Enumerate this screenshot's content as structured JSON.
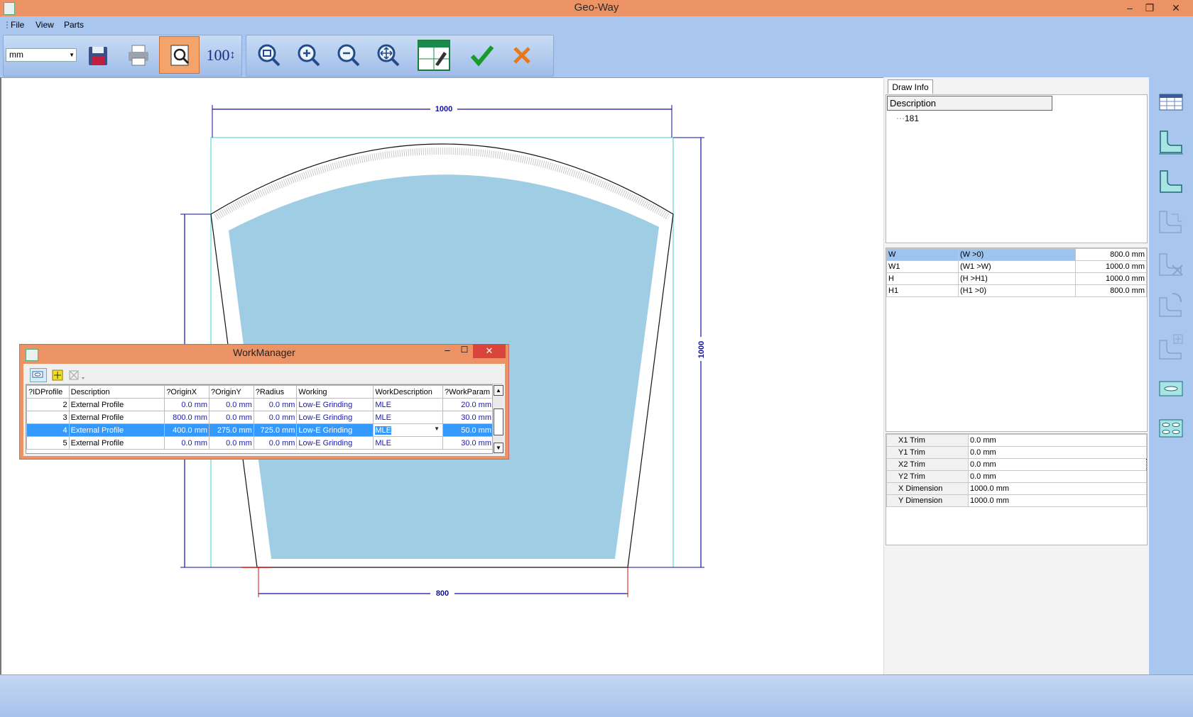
{
  "app": {
    "title": "Geo-Way"
  },
  "window_controls": {
    "minimize": "–",
    "restore": "❐",
    "close": "✕"
  },
  "menu": [
    "File",
    "View",
    "Parts"
  ],
  "toolbar": {
    "unit_value": "mm",
    "zoom_label": "100",
    "icons": [
      "save-icon",
      "print-icon",
      "preview-icon",
      "zoom-100-icon",
      "zoom-window-icon",
      "zoom-in-icon",
      "zoom-out-icon",
      "zoom-pan-icon",
      "draw-info-icon",
      "confirm-icon",
      "cancel-icon"
    ]
  },
  "drawing": {
    "dim_top": "1000",
    "dim_right": "1000",
    "dim_bottom": "800",
    "colors": {
      "glass": "#9ecde4",
      "dimension": "#1010a0",
      "highlight": "#d01010",
      "frame": "#40d0d0"
    }
  },
  "workmanager": {
    "title": "WorkManager",
    "columns": [
      "?IDProfile",
      "Description",
      "?OriginX",
      "?OriginY",
      "?Radius",
      "Working",
      "WorkDescription",
      "?WorkParam"
    ],
    "rows": [
      [
        "2",
        "External Profile",
        "0.0 mm",
        "0.0 mm",
        "0.0 mm",
        "Low-E Grinding",
        "MLE",
        "20.0 mm"
      ],
      [
        "3",
        "External Profile",
        "800.0 mm",
        "0.0 mm",
        "0.0 mm",
        "Low-E Grinding",
        "MLE",
        "30.0 mm"
      ],
      [
        "4",
        "External Profile",
        "400.0 mm",
        "275.0 mm",
        "725.0 mm",
        "Low-E Grinding",
        "MLE",
        "50.0 mm"
      ],
      [
        "5",
        "External Profile",
        "0.0 mm",
        "0.0 mm",
        "0.0 mm",
        "Low-E Grinding",
        "MLE",
        "30.0 mm"
      ]
    ],
    "selected_row": 2
  },
  "draw_info": {
    "tab": "Draw Info",
    "description_header": "Description",
    "item": "181",
    "params": [
      {
        "name": "W",
        "cond": "(W >0)",
        "value": "800.0 mm"
      },
      {
        "name": "W1",
        "cond": "(W1 >W)",
        "value": "1000.0 mm"
      },
      {
        "name": "H",
        "cond": "(H >H1)",
        "value": "1000.0 mm"
      },
      {
        "name": "H1",
        "cond": "(H1 >0)",
        "value": "800.0 mm"
      }
    ],
    "trims": [
      {
        "name": "X1 Trim",
        "value": "0.0 mm"
      },
      {
        "name": "Y1 Trim",
        "value": "0.0 mm"
      },
      {
        "name": "X2 Trim",
        "value": "0.0 mm"
      },
      {
        "name": "Y2 Trim",
        "value": "0.0 mm"
      },
      {
        "name": "X Dimension",
        "value": "1000.0 mm"
      },
      {
        "name": "Y Dimension",
        "value": "1000.0 mm"
      }
    ]
  },
  "sidebar_icons": [
    "table-icon",
    "profile-dimension-icon",
    "profile-shape-icon",
    "profile-multi-icon",
    "profile-delete-icon",
    "profile-edit-icon",
    "profile-add-icon",
    "slot-icon",
    "holes-icon"
  ]
}
